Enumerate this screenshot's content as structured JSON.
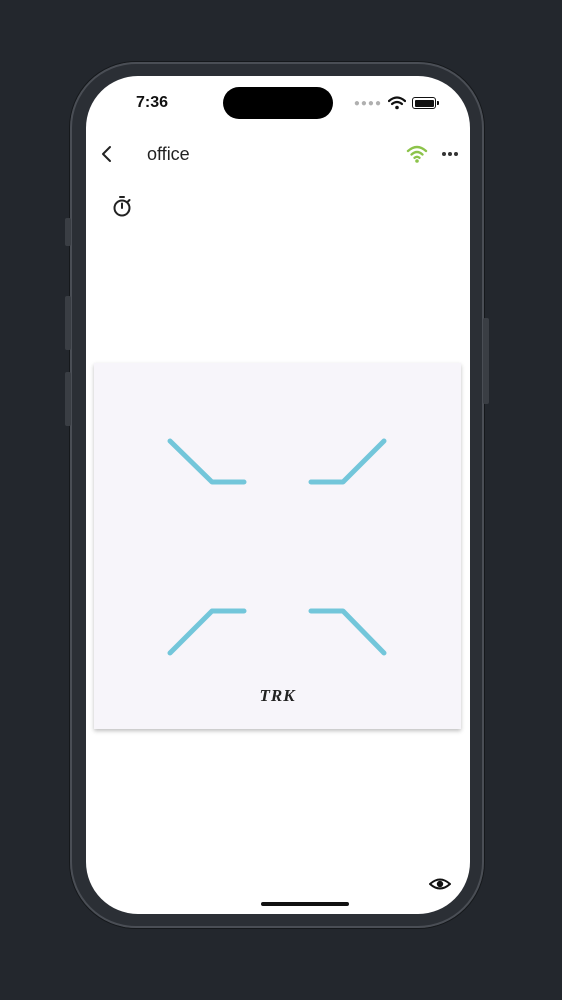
{
  "status_bar": {
    "time": "7:36"
  },
  "header": {
    "title": "office"
  },
  "panel": {
    "brand": "TRK"
  },
  "icons": {
    "back": "chevron-left-icon",
    "connection": "wifi-icon",
    "more": "more-horizontal-icon",
    "timer": "stopwatch-icon",
    "visibility": "eye-icon"
  },
  "colors": {
    "accent_wifi": "#8cc34a",
    "light_strip": "#73c6da",
    "panel_bg": "#f7f5fa"
  }
}
